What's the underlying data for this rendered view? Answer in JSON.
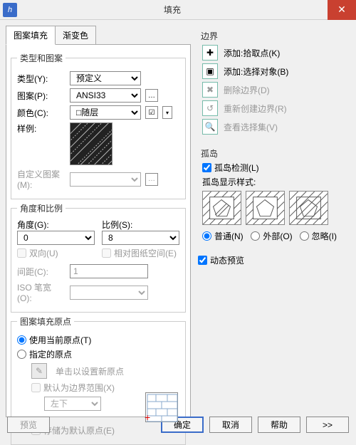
{
  "window": {
    "title": "填充"
  },
  "tabs": {
    "hatch": "图案填充",
    "gradient": "渐变色"
  },
  "type_group": {
    "legend": "类型和图案",
    "type_label": "类型(Y):",
    "type_value": "预定义",
    "pattern_label": "图案(P):",
    "pattern_value": "ANSI33",
    "color_label": "颜色(C):",
    "color_value": "□随层",
    "sample_label": "样例:",
    "custom_label": "自定义图案(M):"
  },
  "angle_group": {
    "legend": "角度和比例",
    "angle_label": "角度(G):",
    "angle_value": "0",
    "scale_label": "比例(S):",
    "scale_value": "8",
    "double_label": "双向(U)",
    "relpaper_label": "相对图纸空间(E)",
    "spacing_label": "间距(C):",
    "spacing_value": "1",
    "iso_label": "ISO 笔宽(O):"
  },
  "origin_group": {
    "legend": "图案填充原点",
    "use_current": "使用当前原点(T)",
    "specify": "指定的原点",
    "click_set": "单击以设置新原点",
    "default_ext": "默认为边界范围(X)",
    "position": "左下",
    "store_default": "存储为默认原点(E)"
  },
  "boundary": {
    "legend": "边界",
    "pick": "添加:拾取点(K)",
    "select": "添加:选择对象(B)",
    "remove": "删除边界(D)",
    "recreate": "重新创建边界(R)",
    "view": "查看选择集(V)"
  },
  "islands": {
    "legend": "孤岛",
    "detect": "孤岛检测(L)",
    "style_label": "孤岛显示样式:",
    "normal": "普通(N)",
    "outer": "外部(O)",
    "ignore": "忽略(I)"
  },
  "dynamic_preview": "动态预览",
  "buttons": {
    "preview": "预览",
    "ok": "确定",
    "cancel": "取消",
    "help": "帮助",
    "expand": ">>"
  }
}
